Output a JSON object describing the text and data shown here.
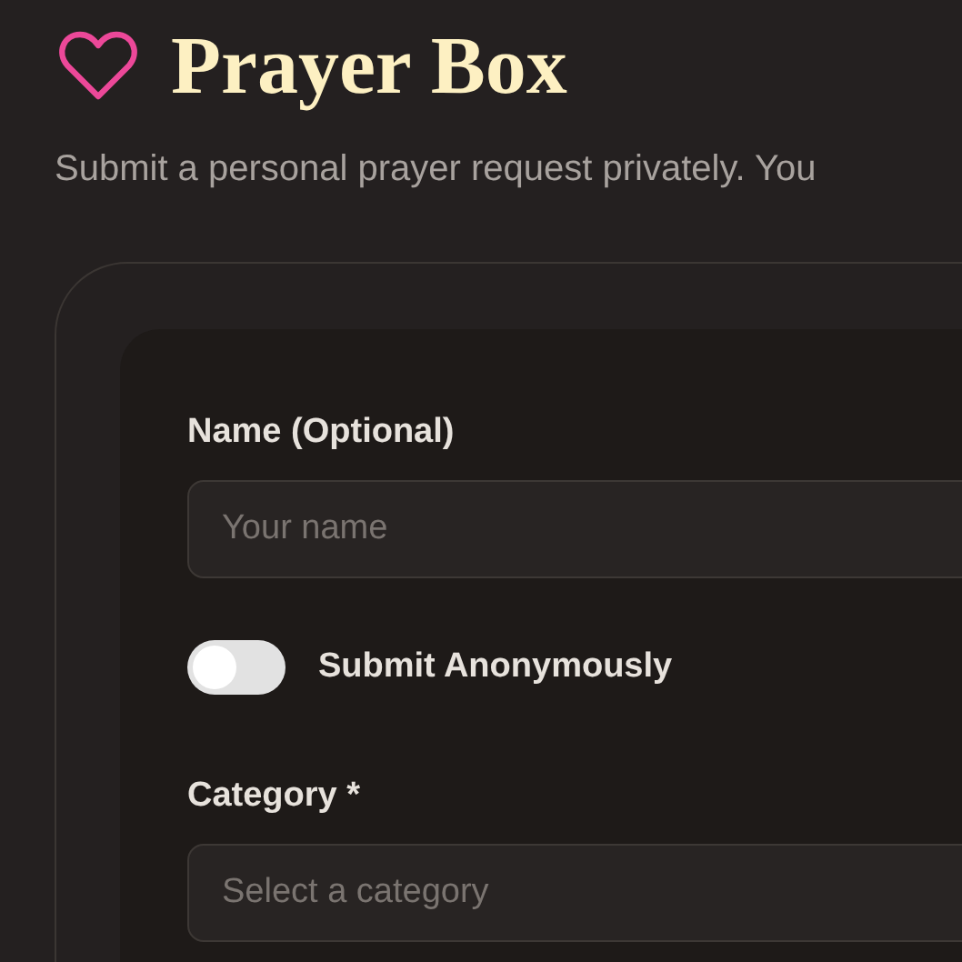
{
  "header": {
    "title": "Prayer Box",
    "subtitle": "Submit a personal prayer request privately. You"
  },
  "form": {
    "fields": [
      {
        "kind": "text",
        "label": "Name (Optional)",
        "placeholder": "Your name"
      },
      {
        "kind": "toggle",
        "label": "Submit Anonymously",
        "on": false
      },
      {
        "kind": "select",
        "label": "Category *",
        "placeholder": "Select a category"
      }
    ]
  }
}
